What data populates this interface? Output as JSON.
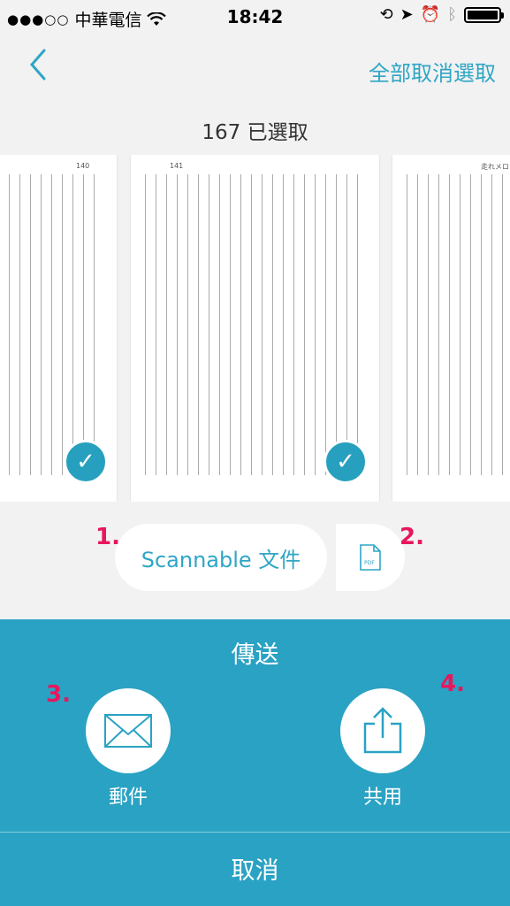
{
  "status_bar": {
    "carrier": "中華電信",
    "time": "18:42",
    "battery_level": 0.92
  },
  "nav": {
    "back_icon": "chevron-left-icon",
    "deselect_all": "全部取消選取"
  },
  "selection": {
    "count_text": "167 已選取"
  },
  "pages": [
    {
      "header": "140",
      "selected": true
    },
    {
      "header": "141",
      "selected": true
    },
    {
      "header": "走れメロス",
      "selected": false
    }
  ],
  "format": {
    "scannable_label": "Scannable 文件",
    "pdf_icon": "pdf-file-icon"
  },
  "annotations": [
    "1.",
    "2.",
    "3.",
    "4."
  ],
  "share_panel": {
    "title": "傳送",
    "mail_label": "郵件",
    "share_label": "共用",
    "cancel": "取消"
  },
  "colors": {
    "accent": "#2ea6c5",
    "panel": "#2aa2c3",
    "annotation": "#e8175d"
  }
}
